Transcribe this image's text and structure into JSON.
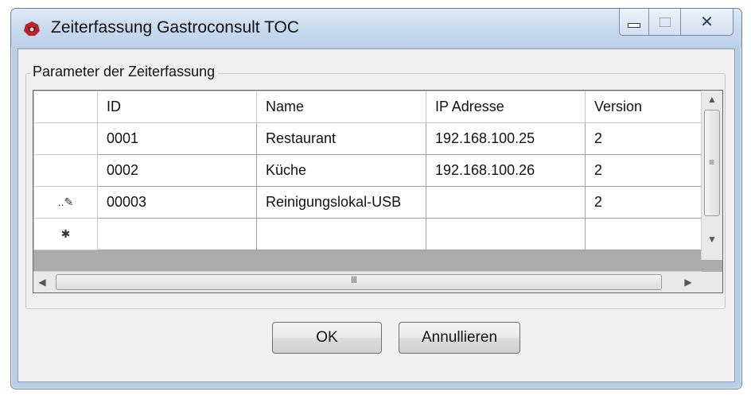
{
  "window": {
    "title": "Zeiterfassung Gastroconsult TOC",
    "icon": "gastroconsult-logo-icon",
    "controls": {
      "minimize": "minimize-icon",
      "maximize": "maximize-icon",
      "close": "close-icon"
    }
  },
  "group": {
    "label": "Parameter der Zeiterfassung"
  },
  "grid": {
    "columns": [
      "ID",
      "Name",
      "IP Adresse",
      "Version"
    ],
    "rows": [
      {
        "marker": "",
        "cells": [
          "0001",
          "Restaurant",
          "192.168.100.25",
          "2"
        ]
      },
      {
        "marker": "",
        "cells": [
          "0002",
          "Küche",
          "192.168.100.26",
          "2"
        ]
      },
      {
        "marker": "..✎",
        "cells": [
          "00003",
          "Reinigungslokal-USB",
          "",
          "2"
        ]
      },
      {
        "marker": "✱",
        "cells": [
          "",
          "",
          "",
          ""
        ]
      }
    ],
    "scroll_grip_h": "III",
    "scroll_grip_v": "≡"
  },
  "buttons": {
    "ok": "OK",
    "cancel": "Annullieren"
  }
}
